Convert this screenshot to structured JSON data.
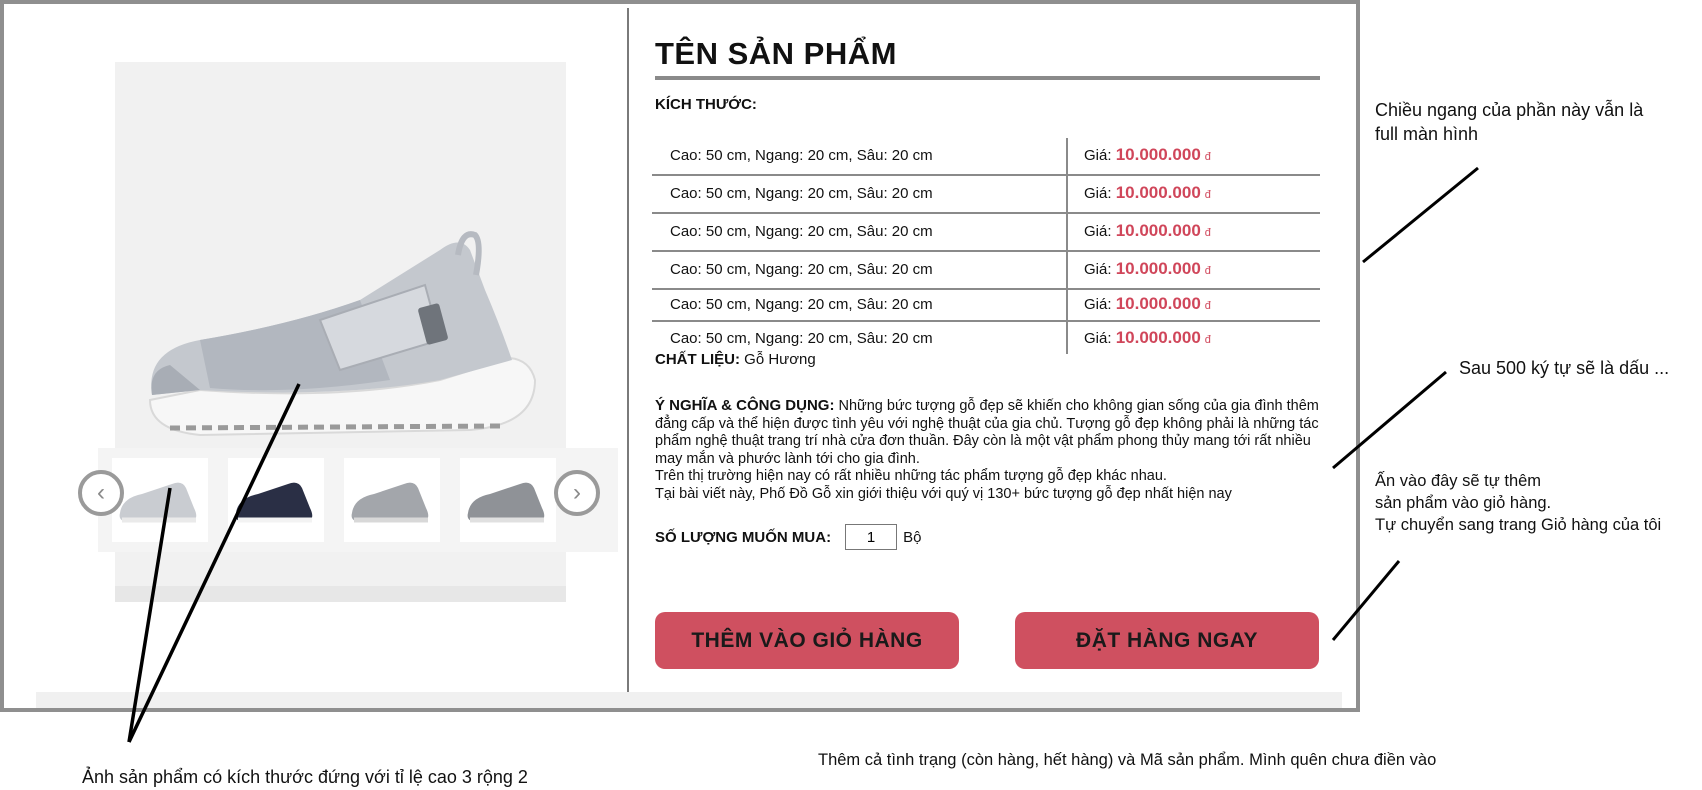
{
  "product": {
    "title": "TÊN SẢN PHẨM",
    "size_label": "KÍCH THƯỚC:",
    "sizes": [
      {
        "dim": "Cao: 50 cm, Ngang: 20 cm, Sâu: 20 cm",
        "price_label": "Giá:",
        "price": "10.000.000",
        "currency": "đ"
      },
      {
        "dim": "Cao: 50 cm, Ngang: 20 cm, Sâu: 20 cm",
        "price_label": "Giá:",
        "price": "10.000.000",
        "currency": "đ"
      },
      {
        "dim": "Cao: 50 cm, Ngang: 20 cm, Sâu: 20 cm",
        "price_label": "Giá:",
        "price": "10.000.000",
        "currency": "đ"
      },
      {
        "dim": "Cao: 50 cm, Ngang: 20 cm, Sâu: 20 cm",
        "price_label": "Giá:",
        "price": "10.000.000",
        "currency": "đ"
      },
      {
        "dim": "Cao: 50 cm, Ngang: 20 cm, Sâu: 20 cm",
        "price_label": "Giá:",
        "price": "10.000.000",
        "currency": "đ"
      },
      {
        "dim": "Cao: 50 cm, Ngang: 20 cm, Sâu: 20 cm",
        "price_label": "Giá:",
        "price": "10.000.000",
        "currency": "đ"
      }
    ],
    "material_label": "CHẤT LIỆU:",
    "material_value": "Gỗ Hương",
    "meaning_label": "Ý NGHĨA & CÔNG DỤNG:",
    "meaning_lines": [
      "Những bức tượng gỗ đẹp sẽ khiến cho không gian sống của gia đình thêm đẳng cấp và thể hiện được tình yêu với nghệ thuật của gia chủ. Tượng gỗ đẹp không phải là những tác phẩm nghệ thuật trang trí nhà cửa đơn thuần. Đây còn là một vật phẩm phong thủy mang tới rất nhiều may mắn và phước lành tới cho gia đình.",
      "Trên thị trường hiện nay có rất nhiều những tác phẩm tượng gỗ đẹp khác nhau.",
      "Tại bài viết này, Phố Đồ Gỗ xin giới thiệu với quý vị 130+ bức tượng gỗ đẹp nhất hiện nay"
    ],
    "qty_label": "SỐ LƯỢNG MUỐN MUA:",
    "qty_value": "1",
    "qty_unit": "Bộ",
    "add_to_cart": "THÊM VÀO GIỎ HÀNG",
    "order_now": "ĐẶT HÀNG NGAY"
  },
  "gallery": {
    "prev_icon": "chevron-left-icon",
    "next_icon": "chevron-right-icon",
    "thumbnail_count": 4
  },
  "annotations": {
    "full_width_l1": "Chiều ngang của phần này vẫn là",
    "full_width_l2": "full màn hình",
    "char_limit": "Sau 500 ký tự sẽ là dấu ...",
    "add_l1": "Ấn vào đây sẽ tự thêm",
    "add_l2": "sản phẩm vào giỏ hàng.",
    "add_l3": "Tự chuyển sang trang Giỏ hàng của tôi",
    "image_ratio": "Ảnh sản phẩm có kích thước đứng với tỉ lệ cao 3 rộng 2",
    "status_note": "Thêm cả tình trạng (còn hàng, hết hàng) và Mã sản phẩm. Mình quên chưa điền vào"
  },
  "colors": {
    "accent": "#cf5060",
    "price": "#d0465a",
    "rule": "#8a8a8a"
  }
}
